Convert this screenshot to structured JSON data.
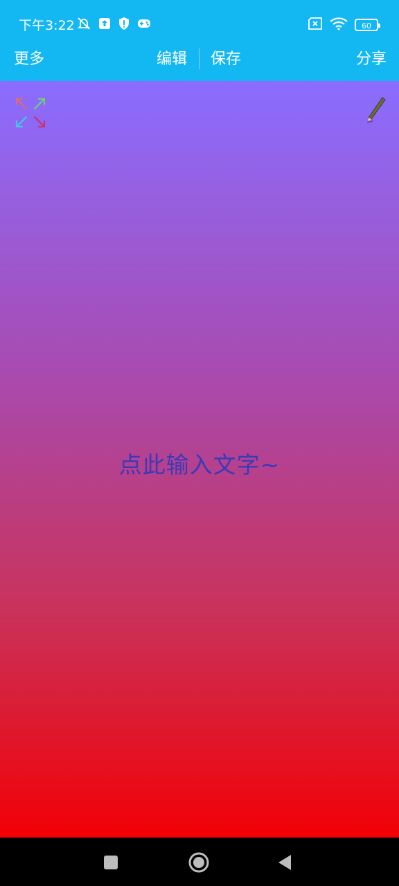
{
  "status_bar": {
    "time": "下午3:22",
    "battery": "60"
  },
  "toolbar": {
    "more_label": "更多",
    "edit_label": "编辑",
    "save_label": "保存",
    "share_label": "分享"
  },
  "canvas": {
    "placeholder_text": "点此输入文字~",
    "gradient_top": "#8a6dff",
    "gradient_bottom": "#f20005"
  },
  "nav": {
    "buttons": [
      "recent-apps",
      "home",
      "back"
    ]
  }
}
